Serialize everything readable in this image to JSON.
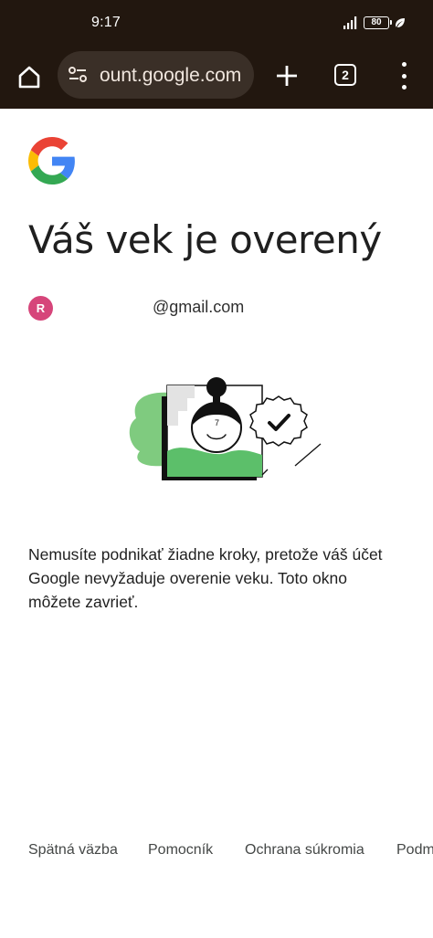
{
  "status_bar": {
    "time": "9:17",
    "battery": "80"
  },
  "browser": {
    "url": "ount.google.com",
    "tab_count": "2"
  },
  "page": {
    "title": "Váš vek je overený",
    "account": {
      "avatar_letter": "R",
      "email": "@gmail.com"
    },
    "body": "Nemusíte podnikať žiadne kroky, pretože váš účet Google nevyžaduje overenie veku. Toto okno môžete zavrieť.",
    "illustration_number": "7"
  },
  "footer": {
    "links": [
      "Spätná väzba",
      "Pomocník",
      "Ochrana súkromia",
      "Podm"
    ]
  },
  "colors": {
    "chrome_bg": "#22170f",
    "omnibox_bg": "#3a2f27",
    "avatar": "#d6457a",
    "illustration_green": "#5cbf6a"
  }
}
